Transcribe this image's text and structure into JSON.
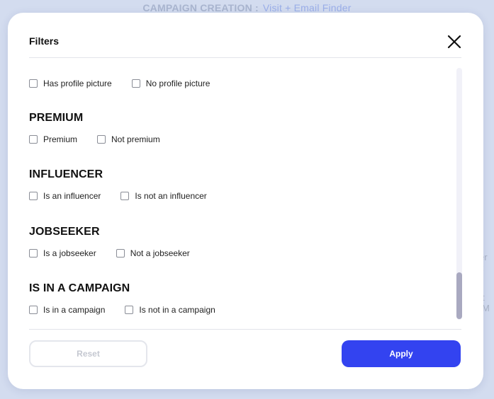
{
  "backdrop": {
    "title": "CAMPAIGN CREATION :",
    "subtitle": "Visit + Email Finder",
    "fragment_1": "er I:",
    "fragment_2": "t M"
  },
  "modal": {
    "title": "Filters",
    "close_icon": "close-icon",
    "sections": [
      {
        "heading": "",
        "options": [
          "Has profile picture",
          "No profile picture"
        ]
      },
      {
        "heading": "PREMIUM",
        "options": [
          "Premium",
          "Not premium"
        ]
      },
      {
        "heading": "INFLUENCER",
        "options": [
          "Is an influencer",
          "Is not an influencer"
        ]
      },
      {
        "heading": "JOBSEEKER",
        "options": [
          "Is a jobseeker",
          "Not a jobseeker"
        ]
      },
      {
        "heading": "IS IN A CAMPAIGN",
        "options": [
          "Is in a campaign",
          "Is not in a campaign"
        ]
      }
    ],
    "reset_label": "Reset",
    "apply_label": "Apply"
  },
  "colors": {
    "accent": "#3343f0",
    "backdrop": "#d3dcef"
  }
}
